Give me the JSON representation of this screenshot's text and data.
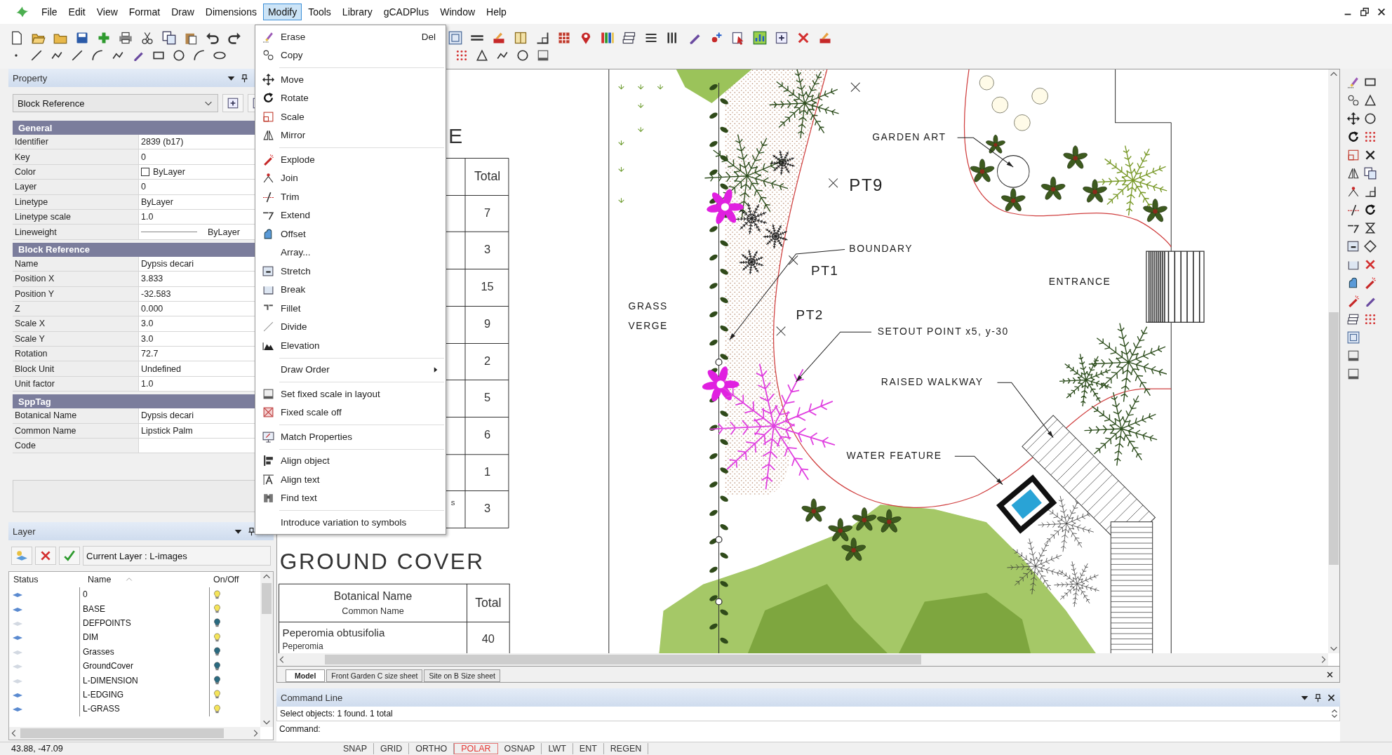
{
  "menu_bar": {
    "items": [
      {
        "label": "File",
        "selected": false
      },
      {
        "label": "Edit",
        "selected": false
      },
      {
        "label": "View",
        "selected": false
      },
      {
        "label": "Format",
        "selected": false
      },
      {
        "label": "Draw",
        "selected": false
      },
      {
        "label": "Dimensions",
        "selected": false
      },
      {
        "label": "Modify",
        "selected": true
      },
      {
        "label": "Tools",
        "selected": false
      },
      {
        "label": "Library",
        "selected": false
      },
      {
        "label": "gCADPlus",
        "selected": false
      },
      {
        "label": "Window",
        "selected": false
      },
      {
        "label": "Help",
        "selected": false
      }
    ]
  },
  "modify_menu": {
    "groups": [
      [
        {
          "label": "Erase",
          "shortcut": "Del",
          "submenu": false
        },
        {
          "label": "Copy",
          "submenu": false
        }
      ],
      [
        {
          "label": "Move",
          "submenu": false
        },
        {
          "label": "Rotate",
          "submenu": false
        },
        {
          "label": "Scale",
          "submenu": false
        },
        {
          "label": "Mirror",
          "submenu": false
        }
      ],
      [
        {
          "label": "Explode",
          "submenu": false
        },
        {
          "label": "Join",
          "submenu": false
        },
        {
          "label": "Trim",
          "submenu": false
        },
        {
          "label": "Extend",
          "submenu": false
        },
        {
          "label": "Offset",
          "submenu": false
        },
        {
          "label": "Array...",
          "submenu": false
        },
        {
          "label": "Stretch",
          "submenu": false
        },
        {
          "label": "Break",
          "submenu": false
        },
        {
          "label": "Fillet",
          "submenu": false
        },
        {
          "label": "Divide",
          "submenu": false
        },
        {
          "label": "Elevation",
          "submenu": false
        }
      ],
      [
        {
          "label": "Draw Order",
          "submenu": true
        }
      ],
      [
        {
          "label": "Set fixed scale in layout",
          "submenu": false
        },
        {
          "label": "Fixed scale off",
          "submenu": false
        }
      ],
      [
        {
          "label": "Match Properties",
          "submenu": false
        }
      ],
      [
        {
          "label": "Align object",
          "submenu": false
        },
        {
          "label": "Align text",
          "submenu": false
        },
        {
          "label": "Find text",
          "submenu": false
        }
      ],
      [
        {
          "label": "Introduce variation to symbols",
          "submenu": false
        }
      ]
    ]
  },
  "property_panel": {
    "title": "Property",
    "selector": "Block Reference",
    "sections": [
      {
        "title": "General",
        "rows": [
          {
            "label": "Identifier",
            "value": "2839 (b17)",
            "kind": "text"
          },
          {
            "label": "Key",
            "value": "0",
            "kind": "text"
          },
          {
            "label": "Color",
            "value": "ByLayer",
            "kind": "color"
          },
          {
            "label": "Layer",
            "value": "0",
            "kind": "text"
          },
          {
            "label": "Linetype",
            "value": "ByLayer",
            "kind": "text"
          },
          {
            "label": "Linetype scale",
            "value": "1.0",
            "kind": "text"
          },
          {
            "label": "Lineweight",
            "value": "ByLayer",
            "kind": "lineweight"
          }
        ]
      },
      {
        "title": "Block Reference",
        "rows": [
          {
            "label": "Name",
            "value": "Dypsis decari",
            "kind": "text"
          },
          {
            "label": "Position X",
            "value": "3.833",
            "kind": "text"
          },
          {
            "label": "Position Y",
            "value": "-32.583",
            "kind": "text"
          },
          {
            "label": "Z",
            "value": "0.000",
            "kind": "text"
          },
          {
            "label": "Scale X",
            "value": "3.0",
            "kind": "text"
          },
          {
            "label": "Scale Y",
            "value": "3.0",
            "kind": "text"
          },
          {
            "label": "Rotation",
            "value": "72.7",
            "kind": "text"
          },
          {
            "label": "Block Unit",
            "value": "Undefined",
            "kind": "text"
          },
          {
            "label": "Unit factor",
            "value": "1.0",
            "kind": "text"
          }
        ]
      },
      {
        "title": "SppTag",
        "rows": [
          {
            "label": "Botanical Name",
            "value": "Dypsis decari",
            "kind": "text"
          },
          {
            "label": "Common Name",
            "value": "Lipstick Palm",
            "kind": "text"
          },
          {
            "label": "Code",
            "kind": "text"
          }
        ]
      }
    ]
  },
  "layer_panel": {
    "title": "Layer",
    "current_layer": "Current Layer : L-images",
    "columns": [
      "Status",
      "Name",
      "On/Off"
    ],
    "rows": [
      {
        "name": "0",
        "on": true
      },
      {
        "name": "BASE",
        "on": true
      },
      {
        "name": "DEFPOINTS",
        "on": false
      },
      {
        "name": "DIM",
        "on": true
      },
      {
        "name": "Grasses",
        "on": false
      },
      {
        "name": "GroundCover",
        "on": false
      },
      {
        "name": "L-DIMENSION",
        "on": false
      },
      {
        "name": "L-EDGING",
        "on": true
      },
      {
        "name": "L-GRASS",
        "on": true
      }
    ]
  },
  "drawing": {
    "labels": [
      "GARDEN ART",
      "PT9",
      "BOUNDARY",
      "PT1",
      "GRASS",
      "VERGE",
      "PT2",
      "SETOUT POINT x5, y-30",
      "ENTRANCE",
      "RAISED WALKWAY",
      "WATER FEATURE"
    ],
    "plant_table": {
      "title_fragment": "E",
      "header": "Total",
      "totals": [
        "7",
        "3",
        "15",
        "9",
        "2",
        "5",
        "6",
        "1",
        "3"
      ],
      "fragment": "s"
    },
    "ground_cover": {
      "title": "GROUND COVER",
      "header_name": "Botanical Name",
      "header_common": "Common Name",
      "header_total": "Total",
      "rows": [
        {
          "botanical": "Peperomia obtusifolia",
          "common": "Peperomia",
          "total": "40"
        }
      ]
    }
  },
  "tabs": [
    {
      "label": "Model",
      "selected": true
    },
    {
      "label": "Front Garden C size sheet",
      "selected": false
    },
    {
      "label": "Site on B Size sheet",
      "selected": false
    }
  ],
  "command_line": {
    "title": "Command Line",
    "history": "Select objects: 1 found.  1 total",
    "prompt": "Command:"
  },
  "status_bar": {
    "coordinates": "43.88, -47.09",
    "toggles": [
      {
        "label": "SNAP",
        "on": false
      },
      {
        "label": "GRID",
        "on": false
      },
      {
        "label": "ORTHO",
        "on": false
      },
      {
        "label": "POLAR",
        "on": true
      },
      {
        "label": "OSNAP",
        "on": false
      },
      {
        "label": "LWT",
        "on": false
      },
      {
        "label": "ENT",
        "on": false
      },
      {
        "label": "REGEN",
        "on": false
      }
    ]
  }
}
